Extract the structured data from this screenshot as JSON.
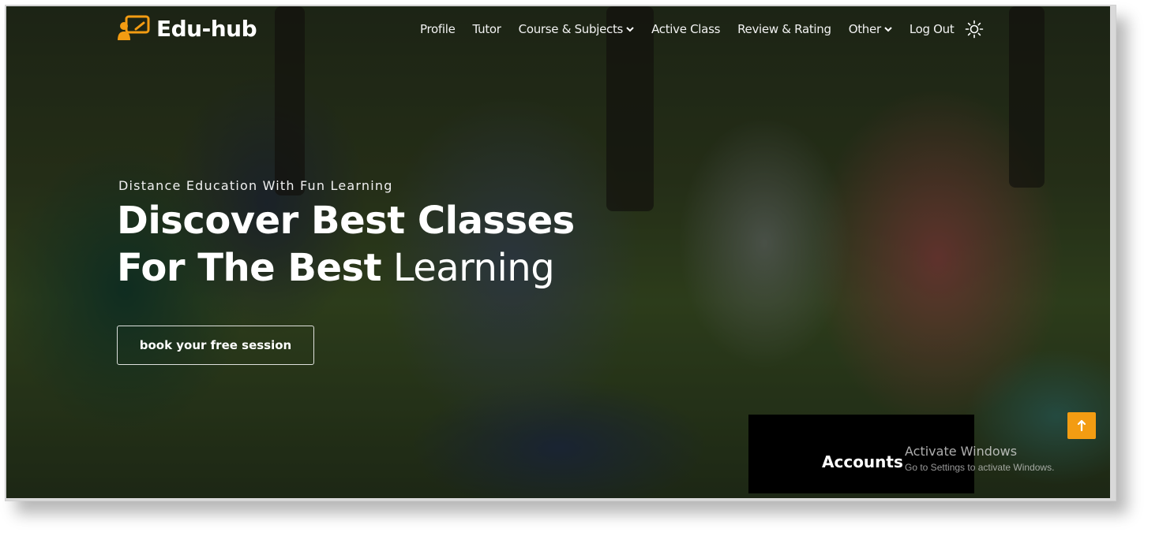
{
  "brand": {
    "name": "Edu-hub",
    "accent": "#f39c12"
  },
  "nav": {
    "profile": "Profile",
    "tutor": "Tutor",
    "course_subjects": "Course & Subjects",
    "active_class": "Active Class",
    "review_rating": "Review & Rating",
    "other": "Other",
    "logout": "Log Out",
    "theme_icon": "sun-icon"
  },
  "hero": {
    "tagline": "Distance Education With Fun Learning",
    "headline_line1": "Discover Best Classes",
    "headline_line2_bold": "For The Best",
    "headline_line2_light": "Learning",
    "cta_label": "book your free session"
  },
  "accounts_label": "Accounts",
  "watermark": {
    "title": "Activate Windows",
    "subtitle": "Go to Settings to activate Windows."
  },
  "scroll_top_icon": "arrow-up-icon"
}
